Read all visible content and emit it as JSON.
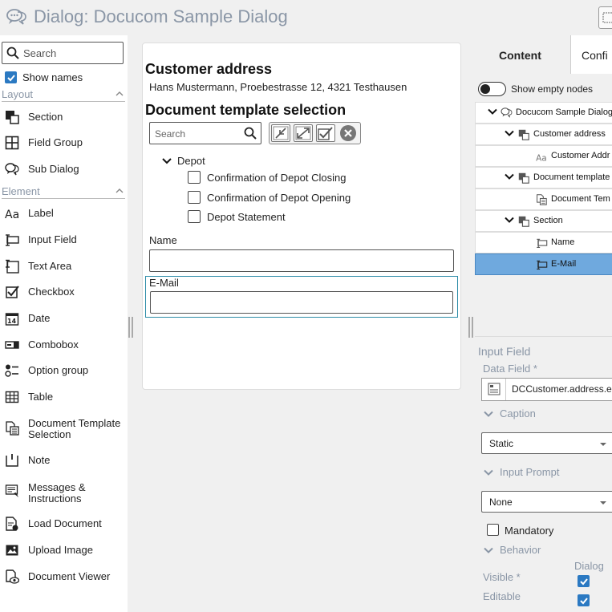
{
  "header": {
    "title": "Dialog: Docucom Sample Dialog"
  },
  "palette": {
    "search_placeholder": "Search",
    "show_names_label": "Show names",
    "show_names_checked": true,
    "layout_group": "Layout",
    "element_group": "Element",
    "layout_items": [
      {
        "label": "Section",
        "icon": "section-icon"
      },
      {
        "label": "Field Group",
        "icon": "field-group-icon"
      },
      {
        "label": "Sub Dialog",
        "icon": "sub-dialog-icon"
      }
    ],
    "element_items": [
      {
        "label": "Label",
        "icon": "label-icon"
      },
      {
        "label": "Input Field",
        "icon": "input-field-icon"
      },
      {
        "label": "Text Area",
        "icon": "text-area-icon"
      },
      {
        "label": "Checkbox",
        "icon": "checkbox-icon"
      },
      {
        "label": "Date",
        "icon": "date-icon"
      },
      {
        "label": "Combobox",
        "icon": "combobox-icon"
      },
      {
        "label": "Option group",
        "icon": "option-group-icon"
      },
      {
        "label": "Table",
        "icon": "table-icon"
      },
      {
        "label": "Document Template Selection",
        "icon": "document-template-icon"
      },
      {
        "label": "Note",
        "icon": "note-icon"
      },
      {
        "label": "Messages & Instructions",
        "icon": "messages-icon"
      },
      {
        "label": "Load Document",
        "icon": "load-document-icon"
      },
      {
        "label": "Upload Image",
        "icon": "upload-image-icon"
      },
      {
        "label": "Document Viewer",
        "icon": "document-viewer-icon"
      }
    ]
  },
  "canvas": {
    "customer_heading": "Customer address",
    "customer_address": "Hans Mustermann, Proebestrasse 12, 4321 Testhausen",
    "template_heading": "Document template selection",
    "template_search_placeholder": "Search",
    "depot_label": "Depot",
    "depot_items": [
      {
        "label": "Confirmation of Depot Closing",
        "checked": false
      },
      {
        "label": "Confirmation of Depot Opening",
        "checked": false
      },
      {
        "label": "Depot Statement",
        "checked": false
      }
    ],
    "name_label": "Name",
    "name_value": "",
    "email_label": "E-Mail",
    "email_value": ""
  },
  "right_panel": {
    "tabs": [
      {
        "label": "Content",
        "active": true
      },
      {
        "label": "Confi",
        "active": false
      }
    ],
    "show_empty_label": "Show empty nodes",
    "tree": [
      {
        "label": "Docucom Sample Dialog",
        "icon": "sub-dialog-icon",
        "expanded": true,
        "selected": false
      },
      {
        "label": "Customer address",
        "icon": "section-icon",
        "expanded": true,
        "selected": false
      },
      {
        "label": "Customer Addr",
        "icon": "label-icon",
        "selected": false
      },
      {
        "label": "Document template",
        "icon": "section-icon",
        "expanded": true,
        "selected": false
      },
      {
        "label": "Document Tem",
        "icon": "document-template-icon",
        "selected": false
      },
      {
        "label": "Section",
        "icon": "section-icon",
        "expanded": true,
        "selected": false
      },
      {
        "label": "Name",
        "icon": "input-field-icon",
        "selected": false
      },
      {
        "label": "E-Mail",
        "icon": "input-field-icon",
        "selected": true
      }
    ],
    "props": {
      "type_label": "Input Field",
      "data_field_label": "Data Field *",
      "data_field_value": "DCCustomer.address.e",
      "caption_label": "Caption",
      "caption_value": "Static",
      "input_prompt_label": "Input Prompt",
      "input_prompt_value": "None",
      "mandatory_label": "Mandatory",
      "mandatory_checked": false,
      "behavior_label": "Behavior",
      "dialog_col_label": "Dialog",
      "visible_label": "Visible *",
      "visible_checked": true,
      "editable_label": "Editable",
      "editable_checked": true
    }
  },
  "colors": {
    "accent": "#2b79c2",
    "selection": "#6fa9de",
    "muted_text": "#8a96a6"
  }
}
